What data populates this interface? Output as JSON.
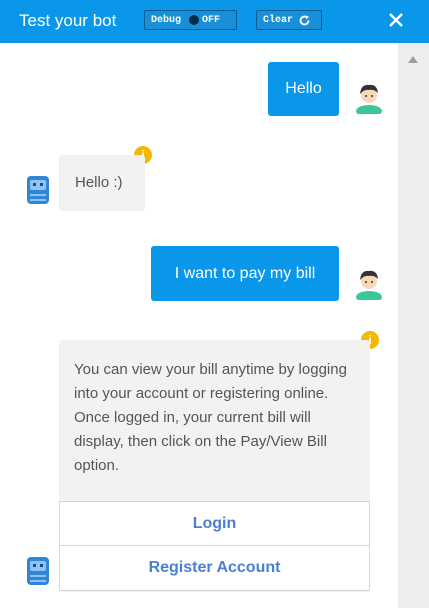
{
  "header": {
    "title": "Test your bot",
    "debug_label": "Debug",
    "debug_state": "OFF",
    "clear_label": "Clear",
    "clear_icon": "refresh-icon",
    "close_icon": "close-icon",
    "background": "#0a97ea"
  },
  "messages": [
    {
      "from": "user",
      "text": "Hello"
    },
    {
      "from": "bot",
      "text": "Hello :)",
      "has_info": true
    },
    {
      "from": "user",
      "text": "I want to pay my bill"
    },
    {
      "from": "bot",
      "text": "You can view your bill anytime by logging into your account or registering online. Once logged in, your current bill will display, then click on the Pay/View Bill option.",
      "has_info": true,
      "buttons": [
        {
          "label": "Login"
        },
        {
          "label": "Register Account"
        }
      ]
    }
  ],
  "info_glyph": "i",
  "colors": {
    "user_bubble": "#0a97ea",
    "bot_bubble": "#f2f2f2",
    "button_text": "#4a7fd6",
    "info_badge": "#f5b800"
  }
}
